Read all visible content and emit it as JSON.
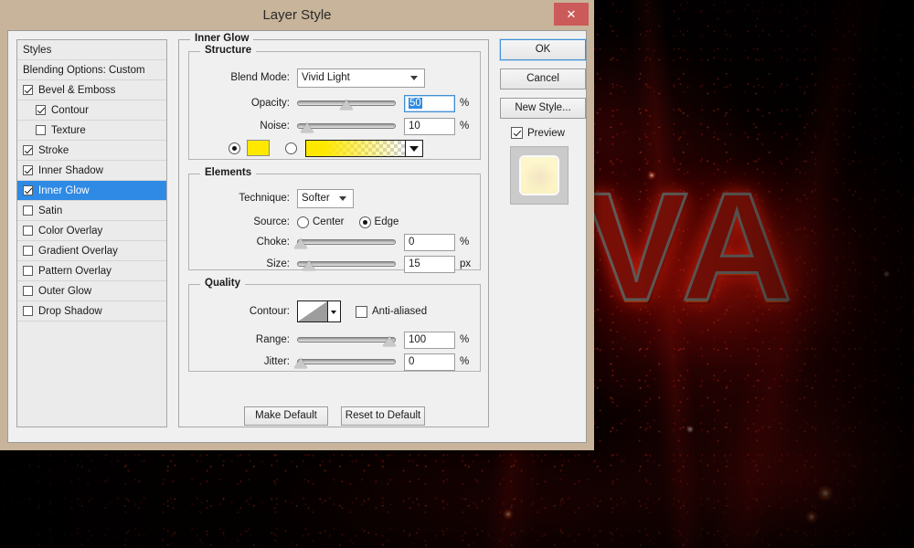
{
  "window": {
    "title": "Layer Style",
    "close_label": "✕"
  },
  "styles_panel": {
    "header": "Styles",
    "blending_options": "Blending Options: Custom",
    "items": [
      {
        "label": "Bevel & Emboss",
        "checked": true,
        "indent": false,
        "selected": false
      },
      {
        "label": "Contour",
        "checked": true,
        "indent": true,
        "selected": false
      },
      {
        "label": "Texture",
        "checked": false,
        "indent": true,
        "selected": false
      },
      {
        "label": "Stroke",
        "checked": true,
        "indent": false,
        "selected": false
      },
      {
        "label": "Inner Shadow",
        "checked": true,
        "indent": false,
        "selected": false
      },
      {
        "label": "Inner Glow",
        "checked": true,
        "indent": false,
        "selected": true
      },
      {
        "label": "Satin",
        "checked": false,
        "indent": false,
        "selected": false
      },
      {
        "label": "Color Overlay",
        "checked": false,
        "indent": false,
        "selected": false
      },
      {
        "label": "Gradient Overlay",
        "checked": false,
        "indent": false,
        "selected": false
      },
      {
        "label": "Pattern Overlay",
        "checked": false,
        "indent": false,
        "selected": false
      },
      {
        "label": "Outer Glow",
        "checked": false,
        "indent": false,
        "selected": false
      },
      {
        "label": "Drop Shadow",
        "checked": false,
        "indent": false,
        "selected": false
      }
    ]
  },
  "effect": {
    "title": "Inner Glow",
    "structure": {
      "title": "Structure",
      "blend_mode_label": "Blend Mode:",
      "blend_mode_value": "Vivid Light",
      "opacity_label": "Opacity:",
      "opacity_value": "50",
      "opacity_unit": "%",
      "opacity_slider_percent": 50,
      "noise_label": "Noise:",
      "noise_value": "10",
      "noise_unit": "%",
      "noise_slider_percent": 10,
      "fill_type": "color",
      "color_hex": "#FFE800",
      "gradient_from": "#FFE800",
      "gradient_to": "transparent"
    },
    "elements": {
      "title": "Elements",
      "technique_label": "Technique:",
      "technique_value": "Softer",
      "source_label": "Source:",
      "source_center_label": "Center",
      "source_edge_label": "Edge",
      "source_value": "Edge",
      "choke_label": "Choke:",
      "choke_value": "0",
      "choke_unit": "%",
      "choke_slider_percent": 0,
      "size_label": "Size:",
      "size_value": "15",
      "size_unit": "px",
      "size_slider_percent": 6
    },
    "quality": {
      "title": "Quality",
      "contour_label": "Contour:",
      "contour_shape": "linear-ramp",
      "anti_aliased_label": "Anti-aliased",
      "anti_aliased_checked": false,
      "range_label": "Range:",
      "range_value": "100",
      "range_unit": "%",
      "range_slider_percent": 100,
      "jitter_label": "Jitter:",
      "jitter_value": "0",
      "jitter_unit": "%",
      "jitter_slider_percent": 0
    }
  },
  "bottom_buttons": {
    "make_default": "Make Default",
    "reset_to_default": "Reset to Default"
  },
  "right_column": {
    "ok": "OK",
    "cancel": "Cancel",
    "new_style": "New Style...",
    "preview_label": "Preview",
    "preview_checked": true
  },
  "background": {
    "artwork_text": "VA",
    "accent_hex": "#C7B49A",
    "selection_hex": "#2E8AE5",
    "close_hex": "#CB5A5A"
  }
}
